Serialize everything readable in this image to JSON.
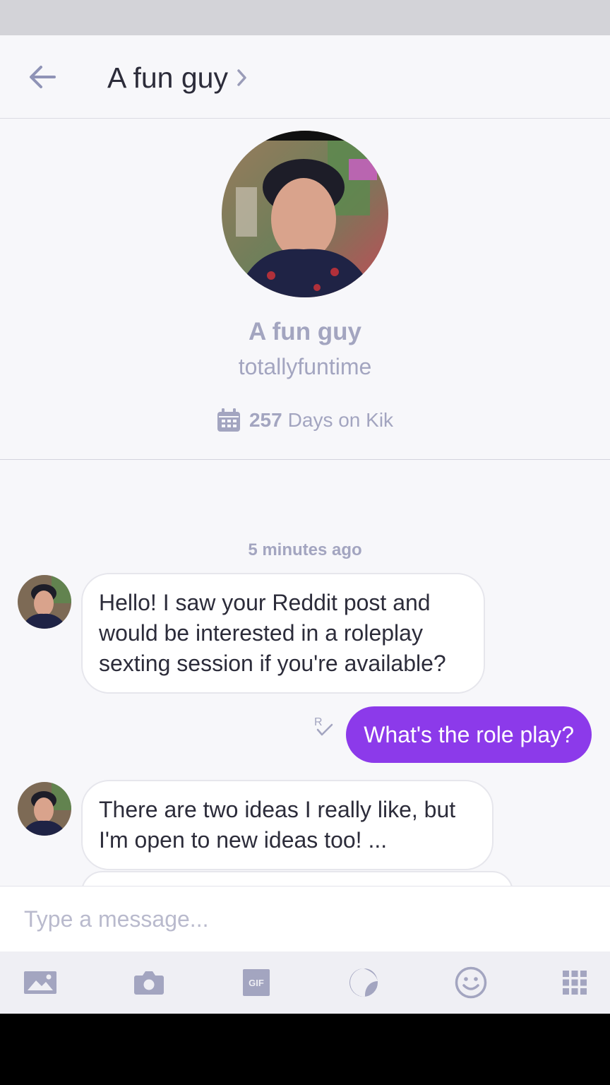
{
  "conversation": {
    "title": "A fun guy"
  },
  "profile": {
    "display_name": "A fun guy",
    "username": "totallyfuntime",
    "days_count": "257",
    "days_label": "Days on Kik"
  },
  "messages": {
    "timestamp": "5 minutes ago",
    "items": [
      {
        "direction": "incoming",
        "text": "Hello! I saw your Reddit post and would be interested in a roleplay sexting session if you're available?"
      },
      {
        "direction": "outgoing",
        "text": "What's the role play?",
        "receipt": "R"
      },
      {
        "direction": "incoming",
        "text": "There are two ideas I really like, but I'm open to new ideas too! ..."
      }
    ]
  },
  "composer": {
    "placeholder": "Type a message..."
  },
  "toolbar": {
    "gif_label": "GIF",
    "items": [
      "gallery-icon",
      "camera-icon",
      "gif-icon",
      "sticker-icon",
      "smiley-icon",
      "apps-grid-icon"
    ]
  },
  "colors": {
    "accent": "#8c3aea",
    "muted": "#a3a5c0",
    "background": "#f7f7fa"
  }
}
